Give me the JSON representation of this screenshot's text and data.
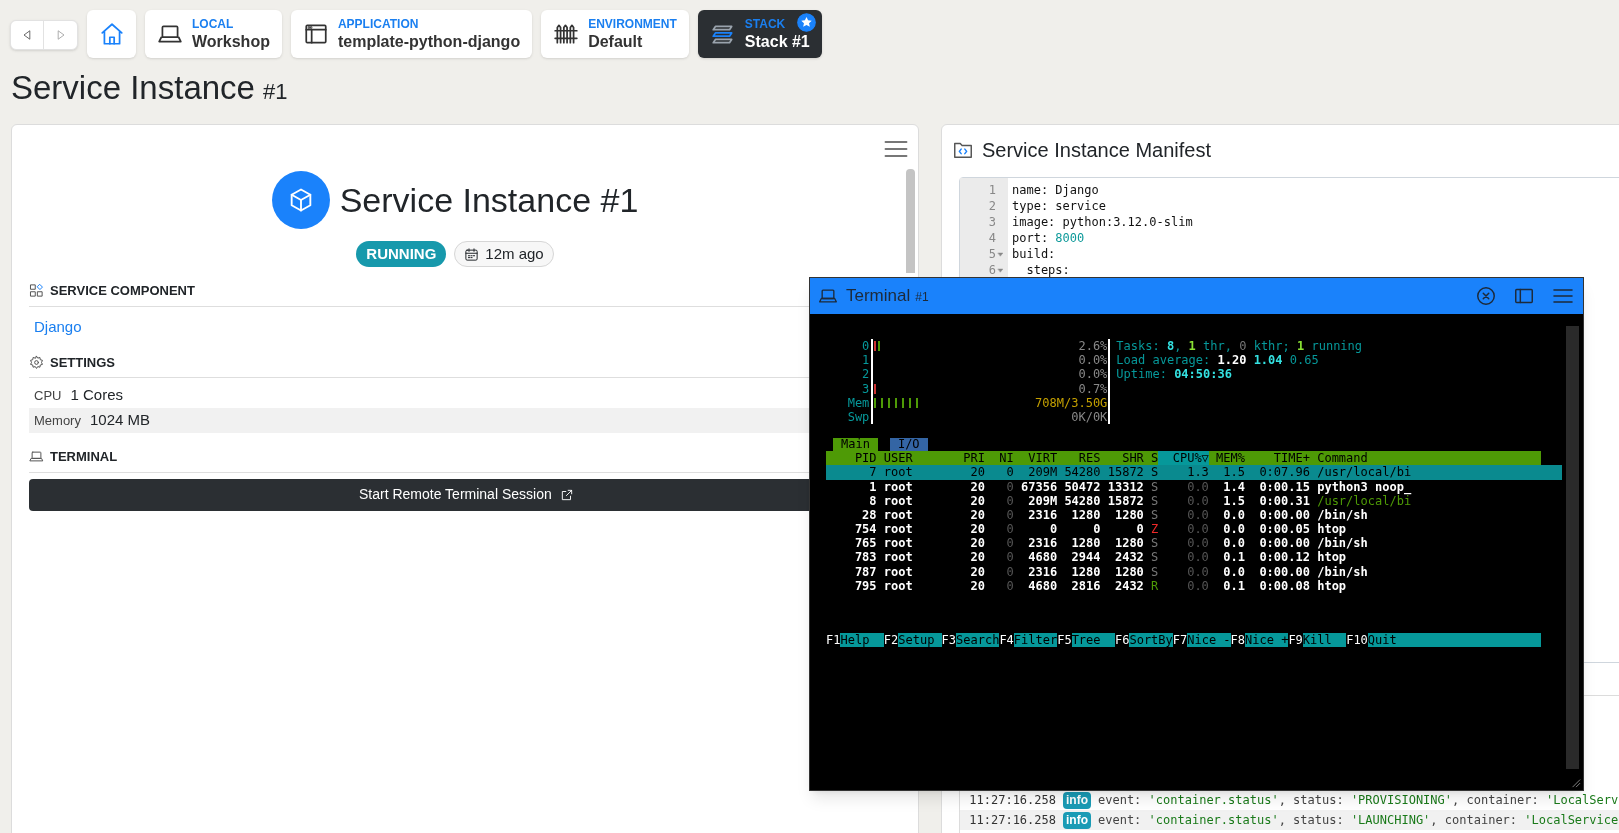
{
  "nav": {
    "crumbs": [
      {
        "kind": "local",
        "label": "LOCAL",
        "value": "Workshop",
        "selected": false
      },
      {
        "kind": "application",
        "label": "APPLICATION",
        "value": "template-python-django",
        "selected": false
      },
      {
        "kind": "environment",
        "label": "ENVIRONMENT",
        "value": "Default",
        "selected": false
      },
      {
        "kind": "stack",
        "label": "STACK",
        "value": "Stack #1",
        "selected": true
      }
    ]
  },
  "page_title": {
    "text": "Service Instance",
    "suffix": "#1"
  },
  "instance_card": {
    "title": "Service Instance #1",
    "status": "RUNNING",
    "age": "12m ago",
    "sections": [
      {
        "kind": "component",
        "heading": "SERVICE COMPONENT",
        "link": "Django"
      },
      {
        "kind": "settings",
        "heading": "SETTINGS",
        "rows": [
          {
            "label": "CPU",
            "value": "1 Cores"
          },
          {
            "label": "Memory",
            "value": "1024 MB"
          }
        ]
      },
      {
        "kind": "terminal",
        "heading": "TERMINAL",
        "button": "Start Remote Terminal Session"
      }
    ]
  },
  "manifest": {
    "title": "Service Instance Manifest",
    "lines": [
      {
        "number": "1",
        "foldable": false,
        "parts": [
          {
            "kind": "text",
            "text": "name: Django"
          }
        ]
      },
      {
        "number": "2",
        "foldable": false,
        "parts": [
          {
            "kind": "text",
            "text": "type: service"
          }
        ]
      },
      {
        "number": "3",
        "foldable": false,
        "parts": [
          {
            "kind": "text",
            "text": "image: python:3.12.0-slim"
          }
        ]
      },
      {
        "number": "4",
        "foldable": false,
        "parts": [
          {
            "kind": "text",
            "text": "port: "
          },
          {
            "kind": "number",
            "text": "8000"
          }
        ]
      },
      {
        "number": "5",
        "foldable": true,
        "parts": [
          {
            "kind": "text",
            "text": "build:"
          }
        ]
      },
      {
        "number": "6",
        "foldable": true,
        "parts": [
          {
            "kind": "text",
            "text": "  steps:"
          }
        ]
      }
    ]
  },
  "log": {
    "rows": [
      {
        "time": "11:27:16.258",
        "level": "info",
        "parts": [
          {
            "kind": "plain",
            "text": "event: "
          },
          {
            "kind": "string",
            "text": "'container.status'"
          },
          {
            "kind": "plain",
            "text": ", status: "
          },
          {
            "kind": "string",
            "text": "'PROVISIONING'"
          },
          {
            "kind": "plain",
            "text": ", container: "
          },
          {
            "kind": "string",
            "text": "'LocalServ"
          }
        ]
      },
      {
        "time": "11:27:16.258",
        "level": "info",
        "parts": [
          {
            "kind": "plain",
            "text": "event: "
          },
          {
            "kind": "string",
            "text": "'container.status'"
          },
          {
            "kind": "plain",
            "text": ", status: "
          },
          {
            "kind": "string",
            "text": "'LAUNCHING'"
          },
          {
            "kind": "plain",
            "text": ", container: "
          },
          {
            "kind": "string",
            "text": "'LocalService"
          }
        ]
      }
    ]
  },
  "terminal": {
    "title": "Terminal",
    "suffix": "#1",
    "htop": {
      "meters": [
        {
          "kind": "cpu",
          "label": "0",
          "level": 0.026,
          "reading": "2.6%"
        },
        {
          "kind": "cpu",
          "label": "1",
          "level": 0,
          "reading": "0.0%"
        },
        {
          "kind": "cpu",
          "label": "2",
          "level": 0,
          "reading": "0.0%"
        },
        {
          "kind": "cpu",
          "label": "3",
          "level": 0.007,
          "reading": "0.7%"
        },
        {
          "kind": "memory",
          "label": "Mem",
          "level": 0.2,
          "reading": "708M/3.50G"
        },
        {
          "kind": "swap",
          "label": "Swp",
          "level": 0,
          "reading": "0K/0K"
        }
      ],
      "info": [
        [
          {
            "kind": "label",
            "text": "Tasks: "
          },
          {
            "kind": "value",
            "text": "8"
          },
          {
            "kind": "label",
            "text": ", "
          },
          {
            "kind": "green",
            "text": "1"
          },
          {
            "kind": "label",
            "text": " thr, "
          },
          {
            "kind": "dim",
            "text": "0"
          },
          {
            "kind": "label",
            "text": " kthr; "
          },
          {
            "kind": "green",
            "text": "1"
          },
          {
            "kind": "label",
            "text": " running"
          }
        ],
        [
          {
            "kind": "label",
            "text": "Load average: "
          },
          {
            "kind": "white",
            "text": "1.20"
          },
          {
            "kind": "value",
            "text": " 1.04"
          },
          {
            "kind": "label",
            "text": " 0.65"
          }
        ],
        [
          {
            "kind": "label",
            "text": "Uptime: "
          },
          {
            "kind": "value",
            "text": "04:50:36"
          }
        ]
      ],
      "tabs": [
        {
          "label": "Main",
          "selected": true
        },
        {
          "label": "I/O",
          "selected": false
        }
      ],
      "columns": [
        {
          "label": "PID",
          "sorted": false
        },
        {
          "label": "USER",
          "sorted": false
        },
        {
          "label": "PRI",
          "sorted": false
        },
        {
          "label": "NI",
          "sorted": false
        },
        {
          "label": "VIRT",
          "sorted": false
        },
        {
          "label": "RES",
          "sorted": false
        },
        {
          "label": "SHR",
          "sorted": false
        },
        {
          "label": "S",
          "sorted": false
        },
        {
          "label": "CPU%▽",
          "sorted": true
        },
        {
          "label": "MEM%",
          "sorted": false
        },
        {
          "label": "TIME+",
          "sorted": false
        },
        {
          "label": "Command",
          "sorted": false
        }
      ],
      "rows": [
        {
          "selected": true,
          "thread": false,
          "cells": [
            "7",
            "root",
            "20",
            "0",
            "209M",
            "54280",
            "15872",
            "S",
            "1.3",
            "1.5",
            "0:07.96",
            "/usr/local/bi"
          ]
        },
        {
          "selected": false,
          "thread": false,
          "color": "#777777",
          "cells": [
            "1",
            "root",
            "20",
            "0",
            "67356",
            "50472",
            "13312",
            "S",
            "0.0",
            "1.4",
            "0:00.15",
            "python3 noop_"
          ]
        },
        {
          "selected": false,
          "thread": true,
          "color": "#777777",
          "cells": [
            "8",
            "root",
            "20",
            "0",
            "209M",
            "54280",
            "15872",
            "S",
            "0.0",
            "1.5",
            "0:00.31",
            "/usr/local/bi"
          ]
        },
        {
          "selected": false,
          "thread": false,
          "color": "#777777",
          "cells": [
            "28",
            "root",
            "20",
            "0",
            "2316",
            "1280",
            "1280",
            "S",
            "0.0",
            "0.0",
            "0:00.00",
            "/bin/sh"
          ]
        },
        {
          "selected": false,
          "thread": false,
          "color": "#ef2929",
          "cells": [
            "754",
            "root",
            "20",
            "0",
            "0",
            "0",
            "0",
            "Z",
            "0.0",
            "0.0",
            "0:00.05",
            "htop"
          ]
        },
        {
          "selected": false,
          "thread": false,
          "color": "#777777",
          "cells": [
            "765",
            "root",
            "20",
            "0",
            "2316",
            "1280",
            "1280",
            "S",
            "0.0",
            "0.0",
            "0:00.00",
            "/bin/sh"
          ]
        },
        {
          "selected": false,
          "thread": false,
          "color": "#777777",
          "cells": [
            "783",
            "root",
            "20",
            "0",
            "4680",
            "2944",
            "2432",
            "S",
            "0.0",
            "0.1",
            "0:00.12",
            "htop"
          ]
        },
        {
          "selected": false,
          "thread": false,
          "color": "#777777",
          "cells": [
            "787",
            "root",
            "20",
            "0",
            "2316",
            "1280",
            "1280",
            "S",
            "0.0",
            "0.0",
            "0:00.00",
            "/bin/sh"
          ]
        },
        {
          "selected": false,
          "thread": false,
          "color": "#4e9a06",
          "cells": [
            "795",
            "root",
            "20",
            "0",
            "4680",
            "2816",
            "2432",
            "R",
            "0.0",
            "0.1",
            "0:00.08",
            "htop"
          ]
        }
      ],
      "function_keys": [
        {
          "key": "F1",
          "label": "Help"
        },
        {
          "key": "F2",
          "label": "Setup"
        },
        {
          "key": "F3",
          "label": "Search"
        },
        {
          "key": "F4",
          "label": "Filter"
        },
        {
          "key": "F5",
          "label": "Tree"
        },
        {
          "key": "F6",
          "label": "SortBy"
        },
        {
          "key": "F7",
          "label": "Nice -"
        },
        {
          "key": "F8",
          "label": "Nice +"
        },
        {
          "key": "F9",
          "label": "Kill"
        },
        {
          "key": "F10",
          "label": "Quit"
        }
      ]
    }
  }
}
